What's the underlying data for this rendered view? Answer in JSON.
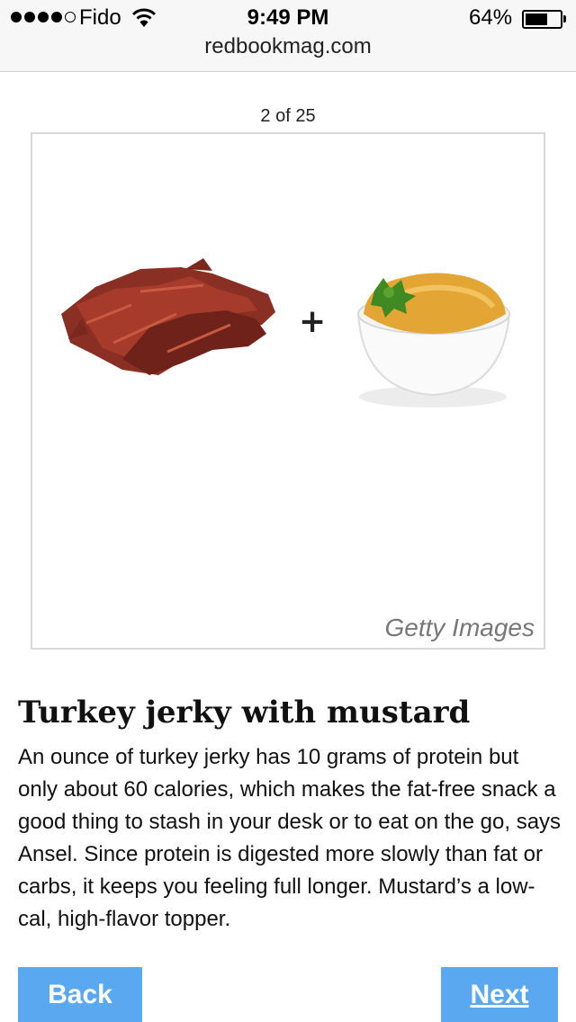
{
  "status_bar": {
    "carrier": "Fido",
    "time": "9:49 PM",
    "battery_percent": "64%",
    "battery_level": 0.64,
    "signal_bars_filled": 4,
    "signal_bars_total": 5
  },
  "browser": {
    "url": "redbookmag.com"
  },
  "slideshow": {
    "counter": "2 of 25",
    "image_credit": "Getty Images",
    "image_icons": [
      "beef-jerky-icon",
      "plus-icon",
      "mustard-bowl-icon"
    ],
    "plus_sign": "+",
    "title": "Turkey jerky with mustard",
    "description": "An ounce of turkey jerky has 10 grams of protein but only about 60 calories, which makes the fat-free snack a good thing to stash in your desk or to eat on the go, says Ansel. Since protein is digested more slowly than fat or carbs, it keeps you feeling full longer. Mustard’s a low-cal, high-flavor topper."
  },
  "navigation": {
    "back_label": "Back",
    "next_label": "Next"
  },
  "colors": {
    "button_blue": "#5aa9f0",
    "jerky": "#8a2f24",
    "mustard": "#e3a534",
    "parsley": "#3f8a22"
  }
}
